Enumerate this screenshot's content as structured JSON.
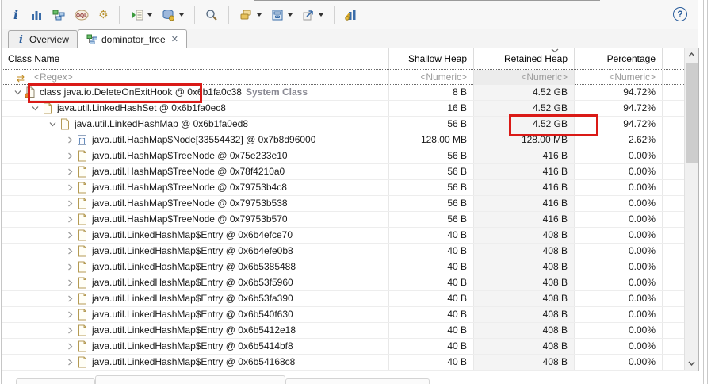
{
  "toolbar": {
    "icons": [
      "info",
      "histogram",
      "dominator-tree",
      "oql",
      "customize-gear",
      "run-expert-test",
      "query-browser",
      "search",
      "group-result",
      "calculator",
      "export",
      "compare-to-another-heap-dump"
    ],
    "help_glyph": "?"
  },
  "tabs": {
    "items": [
      {
        "label": "Overview",
        "icon": "info",
        "active": false
      },
      {
        "label": "dominator_tree",
        "icon": "dominator-tree",
        "active": true,
        "close_glyph": "✕"
      }
    ]
  },
  "table": {
    "columns": [
      {
        "label": "Class Name",
        "align": "left"
      },
      {
        "label": "Shallow Heap",
        "align": "right"
      },
      {
        "label": "Retained Heap",
        "align": "right",
        "sorted": "desc"
      },
      {
        "label": "Percentage",
        "align": "right"
      }
    ],
    "filter_row": {
      "class_name": "<Regex>",
      "shallow_heap": "<Numeric>",
      "retained_heap": "<Numeric>",
      "percentage": "<Numeric>"
    },
    "rows": [
      {
        "level": 0,
        "expanded": true,
        "icon": "class",
        "label": "class java.io.DeleteOnExitHook @ 0x6b1fa0c38",
        "suffix": "System Class",
        "shallow": "8 B",
        "retained": "4.52 GB",
        "percentage": "94.72%"
      },
      {
        "level": 1,
        "expanded": true,
        "icon": "object",
        "label": "java.util.LinkedHashSet @ 0x6b1fa0ec8",
        "shallow": "16 B",
        "retained": "4.52 GB",
        "percentage": "94.72%"
      },
      {
        "level": 2,
        "expanded": true,
        "icon": "object",
        "label": "java.util.LinkedHashMap @ 0x6b1fa0ed8",
        "shallow": "56 B",
        "retained": "4.52 GB",
        "percentage": "94.72%"
      },
      {
        "level": 3,
        "expanded": false,
        "icon": "array",
        "label": "java.util.HashMap$Node[33554432] @ 0x7b8d96000",
        "shallow": "128.00 MB",
        "retained": "128.00 MB",
        "percentage": "2.62%"
      },
      {
        "level": 3,
        "expanded": false,
        "icon": "object",
        "label": "java.util.HashMap$TreeNode @ 0x75e233e10",
        "shallow": "56 B",
        "retained": "416 B",
        "percentage": "0.00%"
      },
      {
        "level": 3,
        "expanded": false,
        "icon": "object",
        "label": "java.util.HashMap$TreeNode @ 0x78f4210a0",
        "shallow": "56 B",
        "retained": "416 B",
        "percentage": "0.00%"
      },
      {
        "level": 3,
        "expanded": false,
        "icon": "object",
        "label": "java.util.HashMap$TreeNode @ 0x79753b4c8",
        "shallow": "56 B",
        "retained": "416 B",
        "percentage": "0.00%"
      },
      {
        "level": 3,
        "expanded": false,
        "icon": "object",
        "label": "java.util.HashMap$TreeNode @ 0x79753b538",
        "shallow": "56 B",
        "retained": "416 B",
        "percentage": "0.00%"
      },
      {
        "level": 3,
        "expanded": false,
        "icon": "object",
        "label": "java.util.HashMap$TreeNode @ 0x79753b570",
        "shallow": "56 B",
        "retained": "416 B",
        "percentage": "0.00%"
      },
      {
        "level": 3,
        "expanded": false,
        "icon": "object",
        "label": "java.util.LinkedHashMap$Entry @ 0x6b4efce70",
        "shallow": "40 B",
        "retained": "408 B",
        "percentage": "0.00%"
      },
      {
        "level": 3,
        "expanded": false,
        "icon": "object",
        "label": "java.util.LinkedHashMap$Entry @ 0x6b4efe0b8",
        "shallow": "40 B",
        "retained": "408 B",
        "percentage": "0.00%"
      },
      {
        "level": 3,
        "expanded": false,
        "icon": "object",
        "label": "java.util.LinkedHashMap$Entry @ 0x6b5385488",
        "shallow": "40 B",
        "retained": "408 B",
        "percentage": "0.00%"
      },
      {
        "level": 3,
        "expanded": false,
        "icon": "object",
        "label": "java.util.LinkedHashMap$Entry @ 0x6b53f5960",
        "shallow": "40 B",
        "retained": "408 B",
        "percentage": "0.00%"
      },
      {
        "level": 3,
        "expanded": false,
        "icon": "object",
        "label": "java.util.LinkedHashMap$Entry @ 0x6b53fa390",
        "shallow": "40 B",
        "retained": "408 B",
        "percentage": "0.00%"
      },
      {
        "level": 3,
        "expanded": false,
        "icon": "object",
        "label": "java.util.LinkedHashMap$Entry @ 0x6b540f630",
        "shallow": "40 B",
        "retained": "408 B",
        "percentage": "0.00%"
      },
      {
        "level": 3,
        "expanded": false,
        "icon": "object",
        "label": "java.util.LinkedHashMap$Entry @ 0x6b5412e18",
        "shallow": "40 B",
        "retained": "408 B",
        "percentage": "0.00%"
      },
      {
        "level": 3,
        "expanded": false,
        "icon": "object",
        "label": "java.util.LinkedHashMap$Entry @ 0x6b5414bf8",
        "shallow": "40 B",
        "retained": "408 B",
        "percentage": "0.00%"
      },
      {
        "level": 3,
        "expanded": false,
        "icon": "object",
        "label": "java.util.LinkedHashMap$Entry @ 0x6b54168c8",
        "shallow": "40 B",
        "retained": "408 B",
        "percentage": "0.00%"
      }
    ]
  },
  "annotations": {
    "color": "#da1a17",
    "boxes": [
      {
        "target": "row 1 class name: class java.io.DeleteOnExitHook @"
      },
      {
        "target": "row 3 retained heap value: 4.52 GB"
      }
    ]
  }
}
